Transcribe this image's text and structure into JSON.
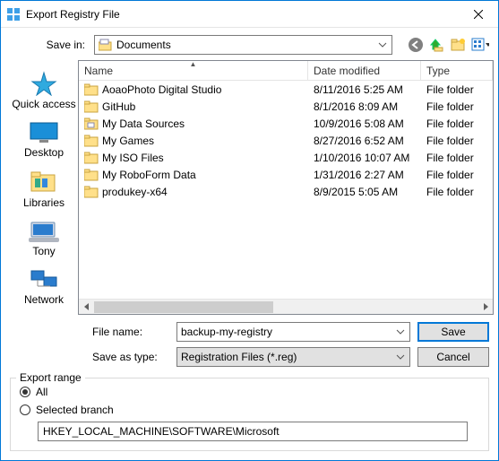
{
  "window": {
    "title": "Export Registry File"
  },
  "savein": {
    "label": "Save in:",
    "value": "Documents"
  },
  "places": [
    {
      "id": "quick-access",
      "label": "Quick access"
    },
    {
      "id": "desktop",
      "label": "Desktop"
    },
    {
      "id": "libraries",
      "label": "Libraries"
    },
    {
      "id": "tony",
      "label": "Tony"
    },
    {
      "id": "network",
      "label": "Network"
    }
  ],
  "columns": {
    "name": "Name",
    "date": "Date modified",
    "type": "Type"
  },
  "files": [
    {
      "name": "AoaoPhoto Digital Studio",
      "date": "8/11/2016 5:25 AM",
      "type": "File folder",
      "icon": "folder"
    },
    {
      "name": "GitHub",
      "date": "8/1/2016 8:09 AM",
      "type": "File folder",
      "icon": "folder"
    },
    {
      "name": "My Data Sources",
      "date": "10/9/2016 5:08 AM",
      "type": "File folder",
      "icon": "folder-special"
    },
    {
      "name": "My Games",
      "date": "8/27/2016 6:52 AM",
      "type": "File folder",
      "icon": "folder"
    },
    {
      "name": "My ISO Files",
      "date": "1/10/2016 10:07 AM",
      "type": "File folder",
      "icon": "folder"
    },
    {
      "name": "My RoboForm Data",
      "date": "1/31/2016 2:27 AM",
      "type": "File folder",
      "icon": "folder"
    },
    {
      "name": "produkey-x64",
      "date": "8/9/2015 5:05 AM",
      "type": "File folder",
      "icon": "folder"
    }
  ],
  "filename": {
    "label": "File name:",
    "value": "backup-my-registry"
  },
  "saveastype": {
    "label": "Save as type:",
    "value": "Registration Files (*.reg)"
  },
  "buttons": {
    "save": "Save",
    "cancel": "Cancel"
  },
  "export_range": {
    "legend": "Export range",
    "all": "All",
    "selected_branch": "Selected branch",
    "branch_value": "HKEY_LOCAL_MACHINE\\SOFTWARE\\Microsoft",
    "selected": "all"
  }
}
